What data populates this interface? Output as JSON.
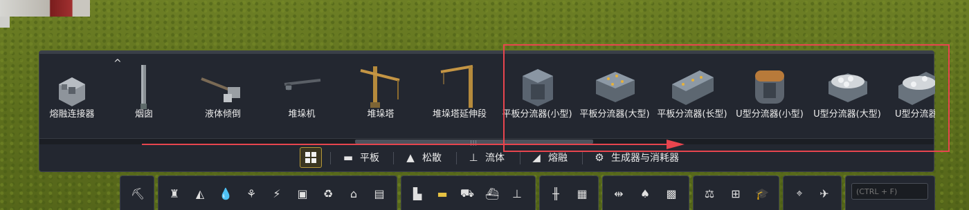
{
  "collapse_caret": "^",
  "items": [
    {
      "label": "熔融连接器",
      "icon": "fluid-connector-icon"
    },
    {
      "label": "烟囱",
      "icon": "chimney-icon"
    },
    {
      "label": "液体倾倒",
      "icon": "liquid-dump-icon"
    },
    {
      "label": "堆垛机",
      "icon": "stacker-icon"
    },
    {
      "label": "堆垛塔",
      "icon": "stacking-tower-icon"
    },
    {
      "label": "堆垛塔延伸段",
      "icon": "stacking-tower-extension-icon"
    },
    {
      "label": "平板分流器(小型)",
      "icon": "flat-splitter-small-icon"
    },
    {
      "label": "平板分流器(大型)",
      "icon": "flat-splitter-large-icon"
    },
    {
      "label": "平板分流器(长型)",
      "icon": "flat-splitter-long-icon"
    },
    {
      "label": "U型分流器(小型)",
      "icon": "u-splitter-small-icon"
    },
    {
      "label": "U型分流器(大型)",
      "icon": "u-splitter-large-icon"
    },
    {
      "label": "U型分流器(长型)",
      "icon": "u-splitter-long-icon"
    }
  ],
  "categories": [
    {
      "label": "平板",
      "icon": "flat-storage-icon"
    },
    {
      "label": "松散",
      "icon": "loose-storage-icon"
    },
    {
      "label": "流体",
      "icon": "fluid-icon"
    },
    {
      "label": "熔融",
      "icon": "molten-icon"
    },
    {
      "label": "生成器与消耗器",
      "icon": "generator-consumer-icon"
    }
  ],
  "toolbar_groups": [
    [
      "demolish-icon"
    ],
    [
      "crane-icon",
      "hopper-icon",
      "droplet-icon",
      "farm-icon",
      "power-icon",
      "container-icon",
      "recycle-icon",
      "factory-icon",
      "storage-icon"
    ],
    [
      "depot-icon",
      "belt-icon",
      "truck-icon",
      "ship-icon",
      "station-icon"
    ],
    [
      "road-icon",
      "train-icon"
    ],
    [
      "terrain-icon",
      "trees-icon",
      "tiles-icon"
    ],
    [
      "balance-icon",
      "blueprint-icon",
      "research-icon"
    ],
    [
      "map-pin-icon",
      "satellite-icon"
    ]
  ],
  "search": {
    "placeholder": "(CTRL + F)"
  },
  "colors": {
    "highlight": "#e8454e",
    "active": "#e7c243",
    "panel": "#232730"
  }
}
